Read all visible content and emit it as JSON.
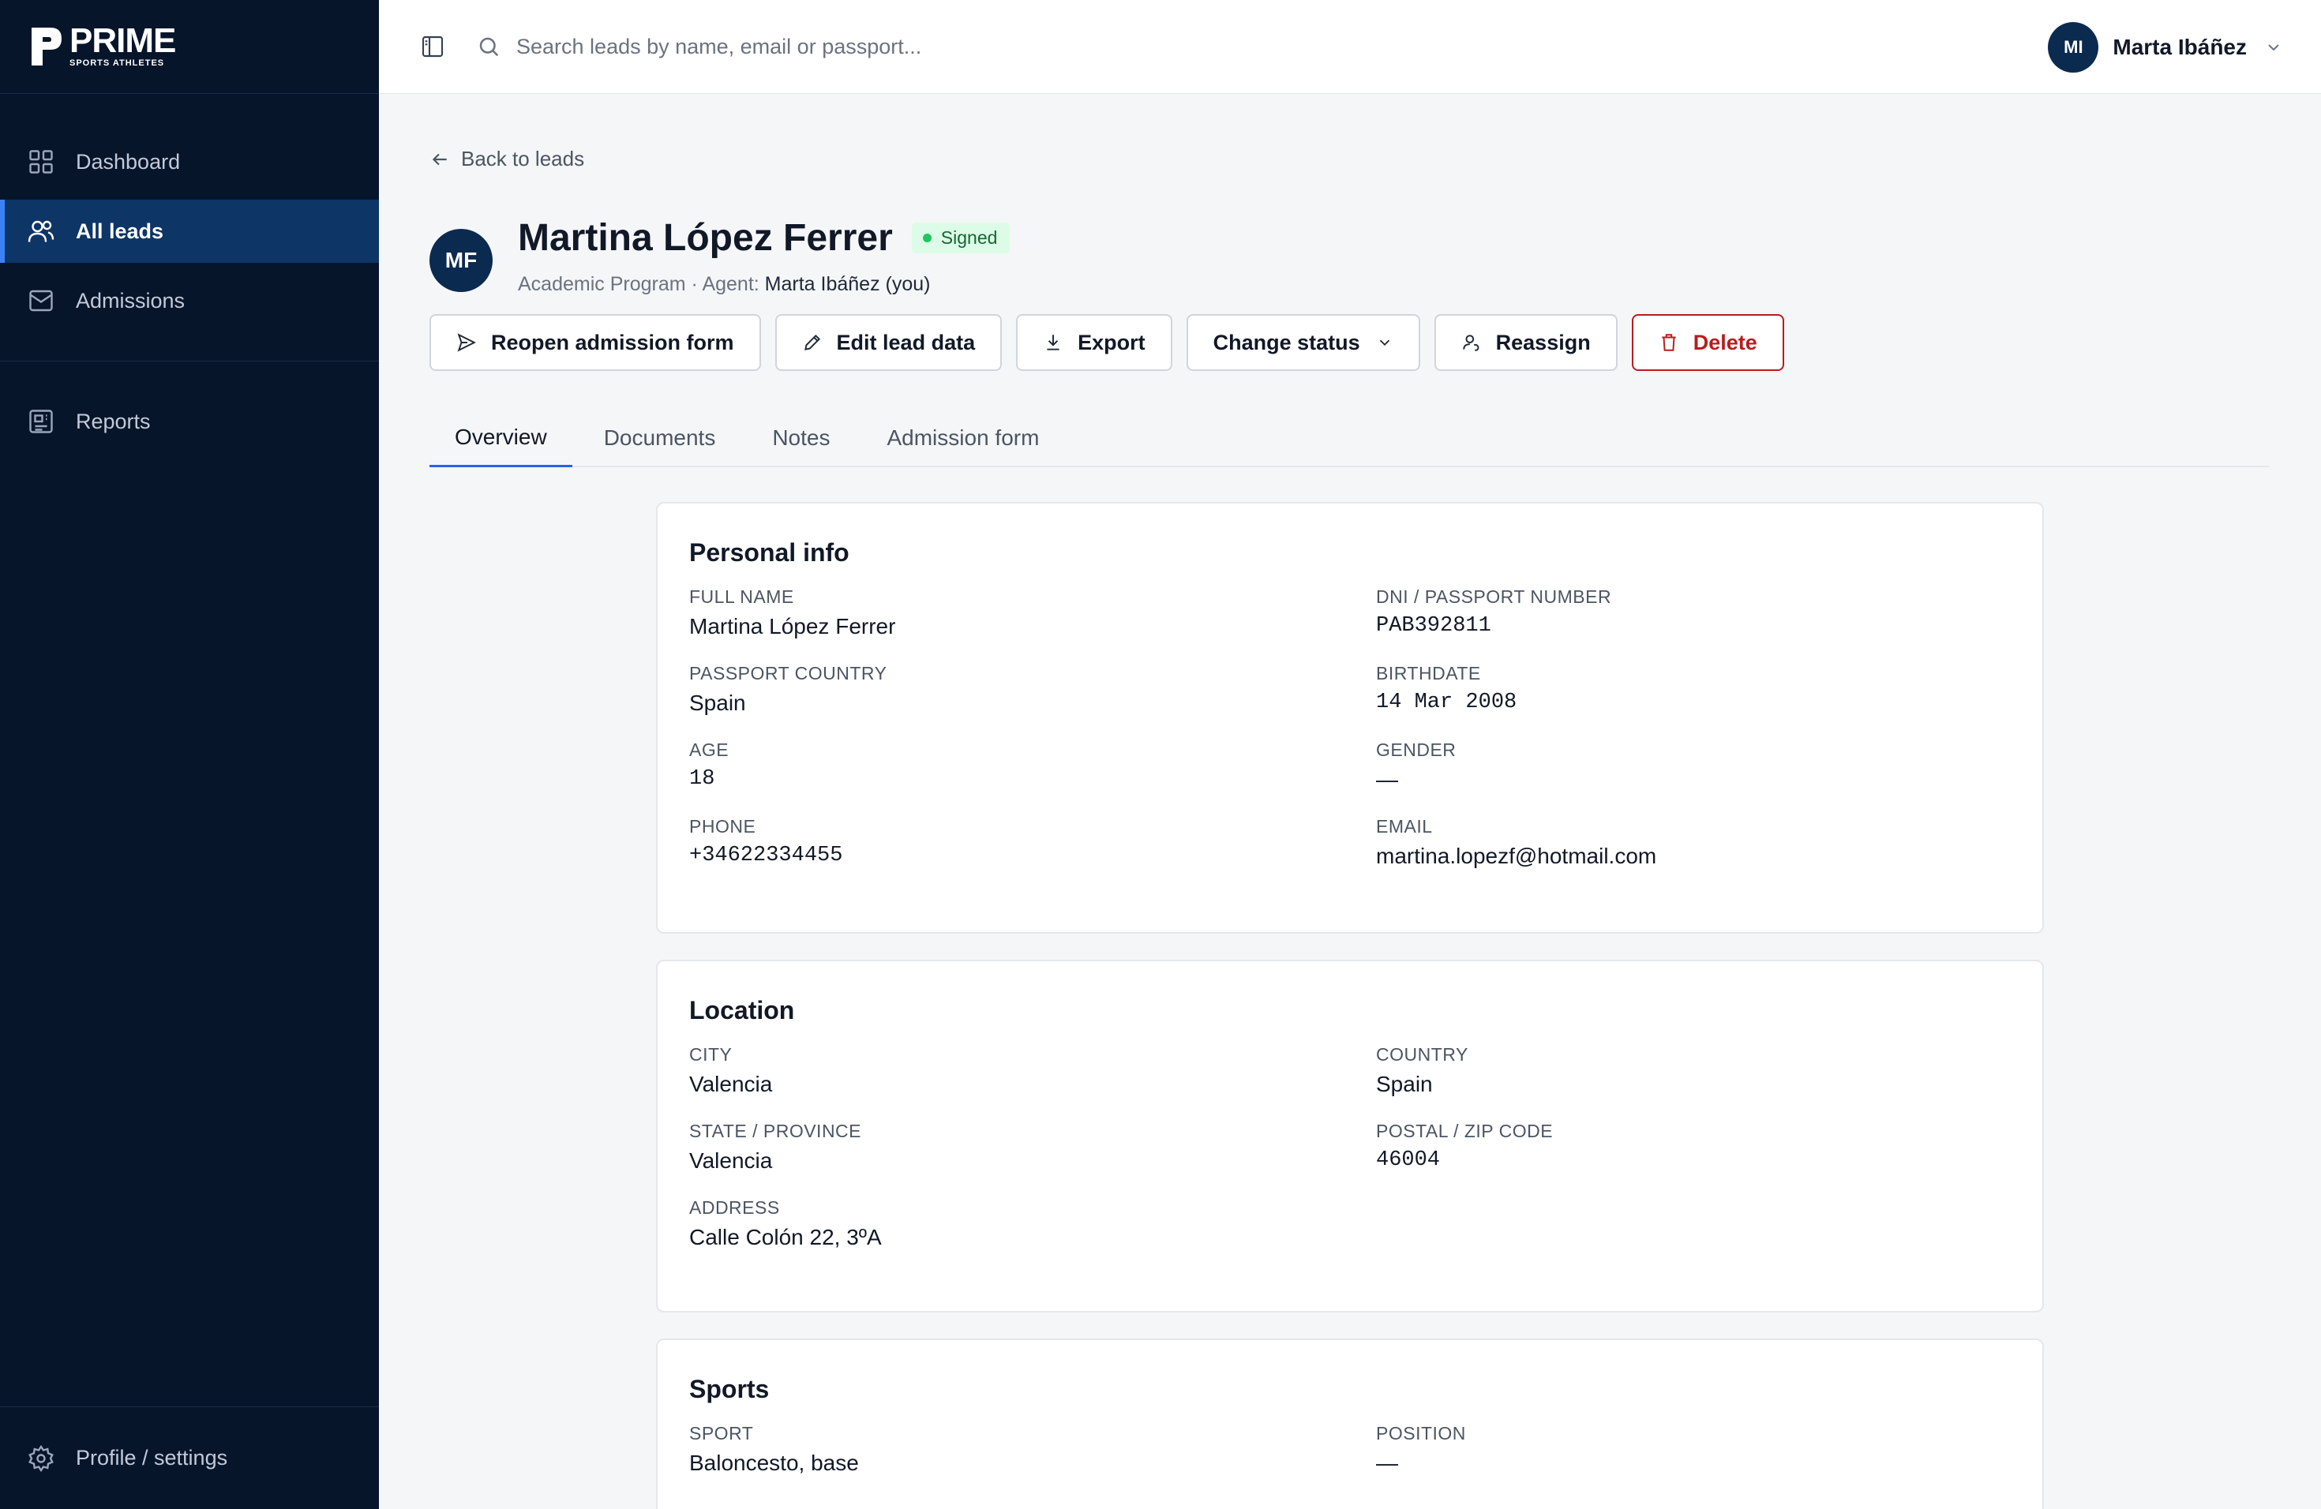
{
  "brand": {
    "name": "PRIME",
    "tagline": "SPORTS ATHLETES"
  },
  "sidebar": {
    "items": [
      {
        "label": "Dashboard",
        "icon": "grid-icon"
      },
      {
        "label": "All leads",
        "icon": "users-icon",
        "active": true
      },
      {
        "label": "Admissions",
        "icon": "inbox-icon"
      },
      {
        "label": "Reports",
        "icon": "report-icon"
      }
    ],
    "footer": {
      "label": "Profile / settings",
      "icon": "gear-icon"
    }
  },
  "topbar": {
    "search_placeholder": "Search leads by name, email or passport...",
    "user": {
      "initials": "MI",
      "name": "Marta Ibáñez"
    }
  },
  "lead": {
    "back_label": "Back to leads",
    "initials": "MF",
    "name": "Martina López Ferrer",
    "status": "Signed",
    "program": "Academic Program",
    "agent_prefix": "Agent:",
    "agent": "Marta Ibáñez (you)"
  },
  "actions": {
    "reopen": "Reopen admission form",
    "edit": "Edit lead data",
    "export": "Export",
    "change_status": "Change status",
    "reassign": "Reassign",
    "delete": "Delete"
  },
  "tabs": [
    "Overview",
    "Documents",
    "Notes",
    "Admission form"
  ],
  "personal": {
    "title": "Personal info",
    "full_name_label": "FULL NAME",
    "full_name": "Martina López Ferrer",
    "passport_label": "DNI / PASSPORT NUMBER",
    "passport": "PAB392811",
    "passport_country_label": "PASSPORT COUNTRY",
    "passport_country": "Spain",
    "birthdate_label": "BIRTHDATE",
    "birthdate": "14 Mar 2008",
    "age_label": "AGE",
    "age": "18",
    "gender_label": "GENDER",
    "gender": "—",
    "phone_label": "PHONE",
    "phone": "+34622334455",
    "email_label": "EMAIL",
    "email": "martina.lopezf@hotmail.com"
  },
  "location": {
    "title": "Location",
    "city_label": "CITY",
    "city": "Valencia",
    "country_label": "COUNTRY",
    "country": "Spain",
    "state_label": "STATE / PROVINCE",
    "state": "Valencia",
    "zip_label": "POSTAL / ZIP CODE",
    "zip": "46004",
    "address_label": "ADDRESS",
    "address": "Calle Colón 22, 3ºA"
  },
  "sports": {
    "title": "Sports",
    "sport_label": "SPORT",
    "sport": "Baloncesto, base",
    "position_label": "POSITION",
    "position": "—"
  },
  "colors": {
    "sidebar_bg": "#07152b",
    "active_nav": "#0d3566",
    "accent": "#2563eb",
    "danger": "#b91c1c",
    "signed_bg": "#dcfce7"
  }
}
